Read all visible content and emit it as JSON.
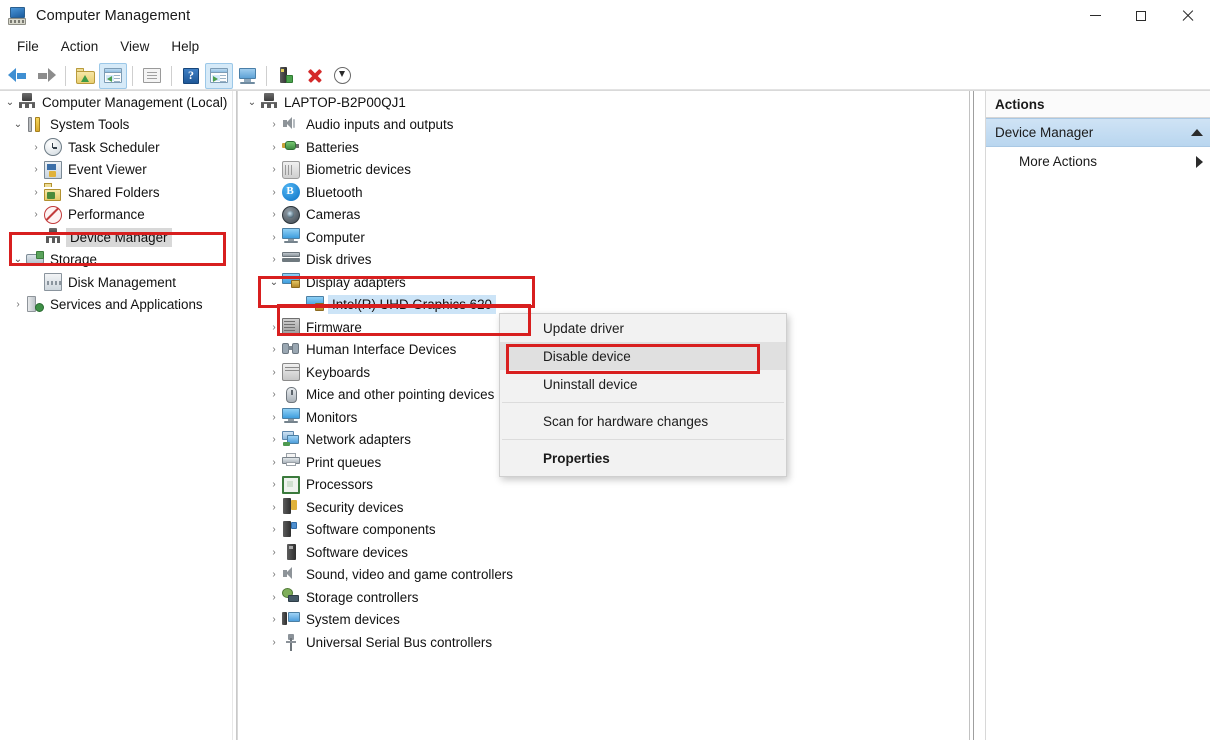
{
  "window": {
    "title": "Computer Management",
    "icon": "computer-management-icon",
    "controls": {
      "minimize": "minimize",
      "maximize": "maximize",
      "close": "close"
    }
  },
  "menubar": {
    "items": [
      "File",
      "Action",
      "View",
      "Help"
    ]
  },
  "toolbar": {
    "items": [
      {
        "name": "back-arrow-icon",
        "tooltip": "Back"
      },
      {
        "name": "forward-arrow-icon",
        "tooltip": "Forward"
      },
      {
        "name": "up-one-level-icon",
        "tooltip": "Up one level"
      },
      {
        "name": "show-hide-console-tree-icon",
        "tooltip": "Show/Hide Console Tree",
        "active": true
      },
      {
        "name": "properties-icon",
        "tooltip": "Properties"
      },
      {
        "name": "help-icon",
        "tooltip": "Help"
      },
      {
        "name": "show-hide-action-pane-icon",
        "tooltip": "Show/Hide Action Pane",
        "active": true
      },
      {
        "name": "console-icon",
        "tooltip": "Console"
      },
      {
        "name": "update-driver-icon",
        "tooltip": "Update driver"
      },
      {
        "name": "uninstall-device-icon",
        "tooltip": "Uninstall device"
      },
      {
        "name": "disable-device-icon",
        "tooltip": "Disable device"
      }
    ]
  },
  "console_tree": {
    "root": {
      "label": "Computer Management (Local)",
      "icon": "computer-icon",
      "expanded": true
    },
    "items": [
      {
        "label": "System Tools",
        "icon": "tools-icon",
        "indent": 1,
        "state": "expanded"
      },
      {
        "label": "Task Scheduler",
        "icon": "clock-icon",
        "indent": 2,
        "state": "collapsed"
      },
      {
        "label": "Event Viewer",
        "icon": "event-viewer-icon",
        "indent": 2,
        "state": "collapsed"
      },
      {
        "label": "Shared Folders",
        "icon": "shared-folders-icon",
        "indent": 2,
        "state": "collapsed"
      },
      {
        "label": "Performance",
        "icon": "performance-icon",
        "indent": 2,
        "state": "collapsed"
      },
      {
        "label": "Device Manager",
        "icon": "device-manager-icon",
        "indent": 2,
        "state": "none",
        "selected": true
      },
      {
        "label": "Storage",
        "icon": "storage-icon",
        "indent": 1,
        "state": "expanded"
      },
      {
        "label": "Disk Management",
        "icon": "disk-management-icon",
        "indent": 2,
        "state": "none"
      },
      {
        "label": "Services and Applications",
        "icon": "services-icon",
        "indent": 1,
        "state": "collapsed"
      }
    ]
  },
  "device_tree": {
    "root": {
      "label": "LAPTOP-B2P00QJ1",
      "icon": "computer-icon",
      "state": "expanded"
    },
    "items": [
      {
        "label": "Audio inputs and outputs",
        "icon": "audio-icon",
        "indent": 1,
        "state": "collapsed"
      },
      {
        "label": "Batteries",
        "icon": "battery-icon",
        "indent": 1,
        "state": "collapsed"
      },
      {
        "label": "Biometric devices",
        "icon": "biometric-icon",
        "indent": 1,
        "state": "collapsed"
      },
      {
        "label": "Bluetooth",
        "icon": "bluetooth-icon",
        "indent": 1,
        "state": "collapsed"
      },
      {
        "label": "Cameras",
        "icon": "camera-icon",
        "indent": 1,
        "state": "collapsed"
      },
      {
        "label": "Computer",
        "icon": "monitor-icon",
        "indent": 1,
        "state": "collapsed"
      },
      {
        "label": "Disk drives",
        "icon": "disk-drive-icon",
        "indent": 1,
        "state": "collapsed"
      },
      {
        "label": "Display adapters",
        "icon": "display-adapter-icon",
        "indent": 1,
        "state": "expanded"
      },
      {
        "label": "Intel(R) UHD Graphics 620",
        "icon": "display-adapter-icon",
        "indent": 2,
        "state": "none",
        "selected": true
      },
      {
        "label": "Firmware",
        "icon": "firmware-icon",
        "indent": 1,
        "state": "collapsed"
      },
      {
        "label": "Human Interface Devices",
        "icon": "hid-icon",
        "indent": 1,
        "state": "collapsed"
      },
      {
        "label": "Keyboards",
        "icon": "keyboard-icon",
        "indent": 1,
        "state": "collapsed"
      },
      {
        "label": "Mice and other pointing devices",
        "icon": "mouse-icon",
        "indent": 1,
        "state": "collapsed"
      },
      {
        "label": "Monitors",
        "icon": "monitor-icon",
        "indent": 1,
        "state": "collapsed"
      },
      {
        "label": "Network adapters",
        "icon": "network-adapter-icon",
        "indent": 1,
        "state": "collapsed"
      },
      {
        "label": "Print queues",
        "icon": "printer-icon",
        "indent": 1,
        "state": "collapsed"
      },
      {
        "label": "Processors",
        "icon": "processor-icon",
        "indent": 1,
        "state": "collapsed"
      },
      {
        "label": "Security devices",
        "icon": "security-device-icon",
        "indent": 1,
        "state": "collapsed"
      },
      {
        "label": "Software components",
        "icon": "software-component-icon",
        "indent": 1,
        "state": "collapsed"
      },
      {
        "label": "Software devices",
        "icon": "software-device-icon",
        "indent": 1,
        "state": "collapsed"
      },
      {
        "label": "Sound, video and game controllers",
        "icon": "sound-icon",
        "indent": 1,
        "state": "collapsed"
      },
      {
        "label": "Storage controllers",
        "icon": "storage-controller-icon",
        "indent": 1,
        "state": "collapsed"
      },
      {
        "label": "System devices",
        "icon": "system-device-icon",
        "indent": 1,
        "state": "collapsed"
      },
      {
        "label": "Universal Serial Bus controllers",
        "icon": "usb-icon",
        "indent": 1,
        "state": "collapsed"
      }
    ]
  },
  "context_menu": {
    "items": [
      {
        "label": "Update driver",
        "highlighted": false,
        "bold": false
      },
      {
        "label": "Disable device",
        "highlighted": true,
        "bold": false
      },
      {
        "label": "Uninstall device",
        "highlighted": false,
        "bold": false
      },
      {
        "separator": true
      },
      {
        "label": "Scan for hardware changes",
        "highlighted": false,
        "bold": false
      },
      {
        "separator": true
      },
      {
        "label": "Properties",
        "highlighted": false,
        "bold": true
      }
    ]
  },
  "actions_pane": {
    "header": "Actions",
    "primary": "Device Manager",
    "more": "More Actions",
    "collapse_icon": "triangle-up-icon",
    "expand_icon": "triangle-right-icon"
  },
  "annotations": {
    "color": "#d81f1f",
    "boxes": [
      {
        "name": "device-manager-highlight",
        "target": "Device Manager"
      },
      {
        "name": "display-adapters-highlight",
        "target": "Display adapters"
      },
      {
        "name": "intel-graphics-highlight",
        "target": "Intel(R) UHD Graphics 620"
      },
      {
        "name": "disable-device-highlight",
        "target": "Disable device"
      }
    ]
  }
}
